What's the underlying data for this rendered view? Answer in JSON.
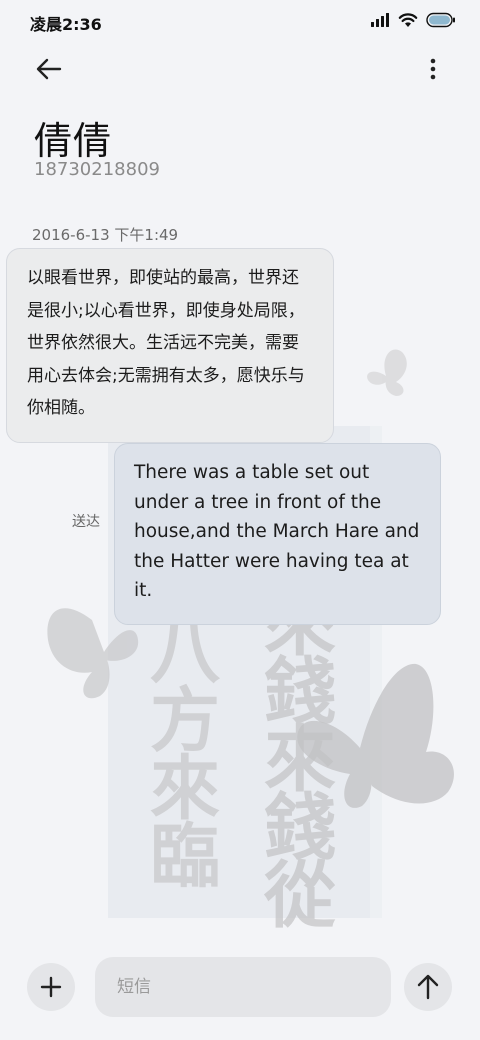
{
  "status_bar": {
    "time": "凌晨2:36",
    "icons": [
      "signal-icon",
      "wifi-icon",
      "battery-icon"
    ]
  },
  "toolbar": {
    "back_icon": "arrow-left-icon",
    "more_icon": "more-vertical-icon"
  },
  "contact": {
    "name": "倩倩",
    "number": "18730218809"
  },
  "conversation": {
    "timestamp": "2016-6-13 下午1:49",
    "messages": [
      {
        "direction": "incoming",
        "text": "以眼看世界，即使站的最高，世界还是很小;以心看世界，即使身处局限，世界依然很大。生活远不完美，需要用心去体会;无需拥有太多，愿快乐与你相随。"
      },
      {
        "direction": "outgoing",
        "text": "There was a table set out under a tree in front of the house,and the March Hare and the Hatter were having tea at it.",
        "status": "送达"
      }
    ]
  },
  "wallpaper": {
    "calligraphy_left": "八方來臨",
    "calligraphy_right": "來錢來錢從"
  },
  "composer": {
    "placeholder": "短信",
    "add_icon": "plus-icon",
    "send_icon": "arrow-up-icon"
  },
  "colors": {
    "background": "#f3f4f7",
    "incoming_bubble": "#ebeced",
    "outgoing_bubble": "#dde2ea",
    "button_bg": "#e4e5e8"
  }
}
